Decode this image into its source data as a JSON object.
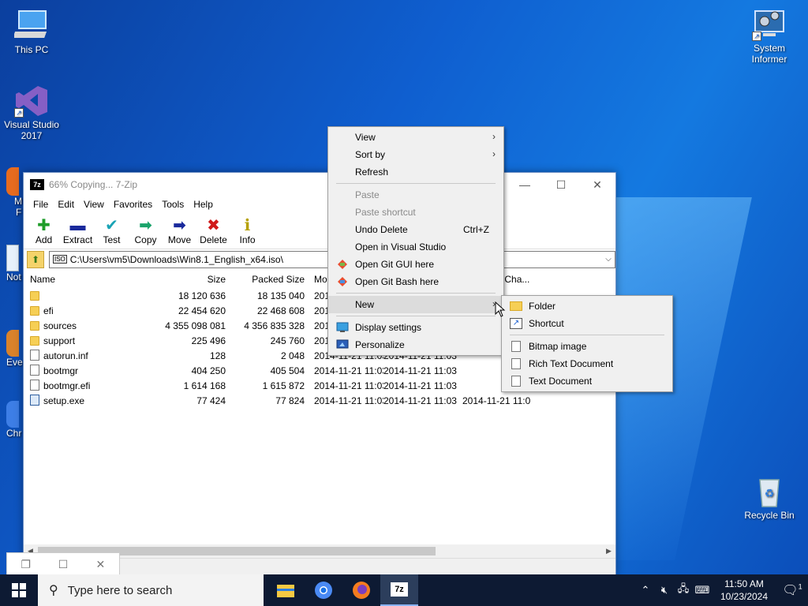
{
  "desktop": {
    "icons": {
      "this_pc": "This PC",
      "visual_studio": "Visual Studio 2017",
      "system_informer": "System Informer",
      "recycle_bin": "Recycle Bin",
      "partial_1": "M",
      "partial_1b": "F",
      "partial_2": "Not",
      "partial_3": "Eve",
      "partial_4": "Chr"
    }
  },
  "window": {
    "title": "66% Copying... 7-Zip",
    "app_icon": "7z",
    "controls": {
      "minimize": "—",
      "maximize": "☐",
      "close": "✕"
    },
    "menu": [
      "File",
      "Edit",
      "View",
      "Favorites",
      "Tools",
      "Help"
    ],
    "toolbar": [
      {
        "label": "Add",
        "icon": "plus-icon",
        "glyph": "✚",
        "color": "#1f9d2a"
      },
      {
        "label": "Extract",
        "icon": "minus-icon",
        "glyph": "▬",
        "color": "#1a2a9c"
      },
      {
        "label": "Test",
        "icon": "check-icon",
        "glyph": "✔",
        "color": "#1aa3b5"
      },
      {
        "label": "Copy",
        "icon": "copy-arrow-icon",
        "glyph": "➡",
        "color": "#1aa36a"
      },
      {
        "label": "Move",
        "icon": "move-arrow-icon",
        "glyph": "➡",
        "color": "#1a2a9c"
      },
      {
        "label": "Delete",
        "icon": "delete-icon",
        "glyph": "✖",
        "color": "#d01a1a"
      },
      {
        "label": "Info",
        "icon": "info-icon",
        "glyph": "ℹ",
        "color": "#b5a000"
      }
    ],
    "address": "C:\\Users\\vm5\\Downloads\\Win8.1_English_x64.iso\\",
    "address_badge": "ISO",
    "columns": {
      "name": "Name",
      "size": "Size",
      "packed": "Packed Size",
      "modified": "Mo",
      "metadata": "Metadata Cha..."
    },
    "rows": [
      {
        "name": "",
        "type": "folder",
        "size": "18 120 636",
        "packed": "18 135 040",
        "modified": "201",
        "created": "",
        "meta": ""
      },
      {
        "name": "efi",
        "type": "folder",
        "size": "22 454 620",
        "packed": "22 468 608",
        "modified": "201",
        "created": "",
        "meta": ""
      },
      {
        "name": "sources",
        "type": "folder",
        "size": "4 355 098 081",
        "packed": "4 356 835 328",
        "modified": "201",
        "created": "",
        "meta": ""
      },
      {
        "name": "support",
        "type": "folder",
        "size": "225 496",
        "packed": "245 760",
        "modified": "201",
        "created": "",
        "meta": ""
      },
      {
        "name": "autorun.inf",
        "type": "file",
        "size": "128",
        "packed": "2 048",
        "modified": "2014-11-21 11:03",
        "created": "2014-11-21 11:03",
        "meta": ""
      },
      {
        "name": "bootmgr",
        "type": "file",
        "size": "404 250",
        "packed": "405 504",
        "modified": "2014-11-21 11:03",
        "created": "2014-11-21 11:03",
        "meta": ""
      },
      {
        "name": "bootmgr.efi",
        "type": "file",
        "size": "1 614 168",
        "packed": "1 615 872",
        "modified": "2014-11-21 11:03",
        "created": "2014-11-21 11:03",
        "meta": ""
      },
      {
        "name": "setup.exe",
        "type": "exe",
        "size": "77 424",
        "packed": "77 824",
        "modified": "2014-11-21 11:03",
        "created": "2014-11-21 11:03",
        "meta": "2014-11-21 11:0"
      }
    ]
  },
  "mini_window": {
    "restore": "❐",
    "maximize": "☐",
    "close": "✕"
  },
  "context_menu": {
    "view": "View",
    "sort_by": "Sort by",
    "refresh": "Refresh",
    "paste": "Paste",
    "paste_shortcut": "Paste shortcut",
    "undo_delete": "Undo Delete",
    "undo_shortcut": "Ctrl+Z",
    "open_vs": "Open in Visual Studio",
    "open_git_gui": "Open Git GUI here",
    "open_git_bash": "Open Git Bash here",
    "new": "New",
    "display_settings": "Display settings",
    "personalize": "Personalize",
    "submenu_arrow": "›"
  },
  "new_submenu": {
    "folder": "Folder",
    "shortcut": "Shortcut",
    "bitmap": "Bitmap image",
    "rtf": "Rich Text Document",
    "text": "Text Document"
  },
  "taskbar": {
    "search_placeholder": "Type here to search",
    "time": "11:50 AM",
    "date": "10/23/2024",
    "notification_count": "1"
  }
}
